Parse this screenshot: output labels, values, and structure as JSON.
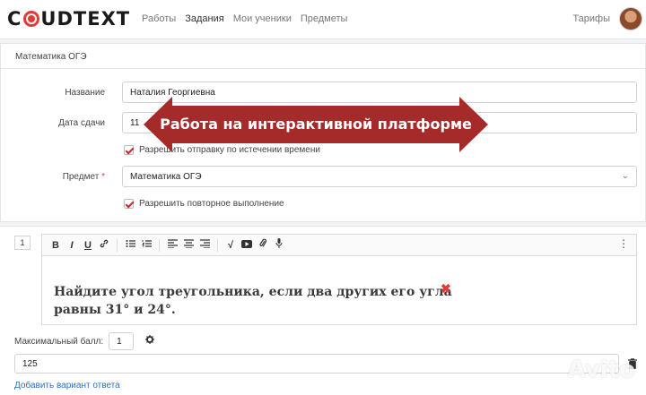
{
  "brand": {
    "logo_left": "C",
    "logo_right": "UDTEXT",
    "accent": "#e53935"
  },
  "nav": {
    "items": [
      "Работы",
      "Задания",
      "Мои ученики",
      "Предметы"
    ],
    "tariffs": "Тарифы"
  },
  "panel": {
    "title": "Математика ОГЭ",
    "name_label": "Название",
    "name_value": "Наталия Георгиевна",
    "date_label": "Дата сдачи",
    "date_value": "11",
    "allow_late_label": "Разрешить отправку по истечении времени",
    "subject_label": "Предмет",
    "subject_required": "*",
    "subject_value": "Математика ОГЭ",
    "allow_retry_label": "Разрешить повторное выполнение"
  },
  "banner": {
    "text": "Работа на интерактивной платформе",
    "color": "#a52a2a"
  },
  "question": {
    "number": "1",
    "toolbar": {
      "bold": "B",
      "italic": "I",
      "underline": "U",
      "link": "🔗",
      "bullets": "☰",
      "numbered": "≡",
      "align_left": "≡",
      "align_center": "≡",
      "align_right": "≡",
      "formula": "√",
      "video": "▶",
      "attach": "📎",
      "audio": "🎙",
      "more": "⋮"
    },
    "text_line1": "Найдите угол треугольника, если два других его угла",
    "text_line2": "равны 31° и 24°.",
    "remove_mark": "✖",
    "max_score_label": "Максимальный балл:",
    "max_score_value": "1",
    "answer_value": "125",
    "add_answer_link": "Добавить вариант ответа"
  },
  "watermark": "Avito"
}
